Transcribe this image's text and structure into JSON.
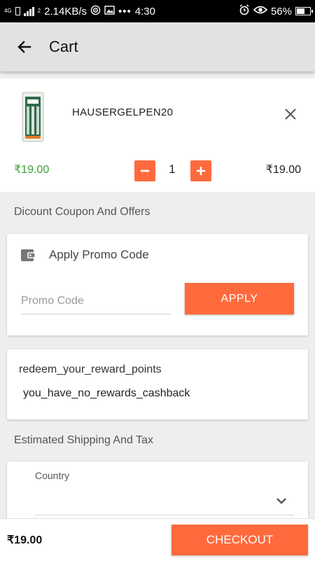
{
  "status_bar": {
    "network_type": "4G",
    "sim_slot": "2",
    "speed": "2.14KB/s",
    "dots": "•••",
    "time": "4:30",
    "battery": "56%",
    "battery_level": 0.56,
    "icons": [
      "signal-icon",
      "sim-icon",
      "hotspot-icon",
      "image-icon",
      "alarm-icon",
      "eye-icon",
      "battery-icon"
    ]
  },
  "app_bar": {
    "title": "Cart",
    "back_icon": "arrow-left-icon"
  },
  "cart_item": {
    "name": "HAUSERGELPEN20",
    "unit_price": "₹19.00",
    "quantity": "1",
    "line_total": "₹19.00"
  },
  "coupon_section": {
    "label": "Dicount Coupon And Offers",
    "card_title": "Apply Promo Code",
    "input_value": "",
    "input_placeholder": "Promo Code",
    "apply_label": "APPLY"
  },
  "reward_section": {
    "title": "redeem_your_reward_points",
    "message": "you_have_no_rewards_cashback"
  },
  "shipping_section": {
    "label": "Estimated Shipping And Tax",
    "country_label": "Country",
    "country_value": ""
  },
  "bottom_bar": {
    "total": "₹19.00",
    "checkout_label": "CHECKOUT"
  },
  "colors": {
    "accent": "#ff6a3d",
    "price_green": "#3aa23a",
    "app_bar_bg": "#e2e2e2",
    "page_bg": "#eeeeee"
  }
}
